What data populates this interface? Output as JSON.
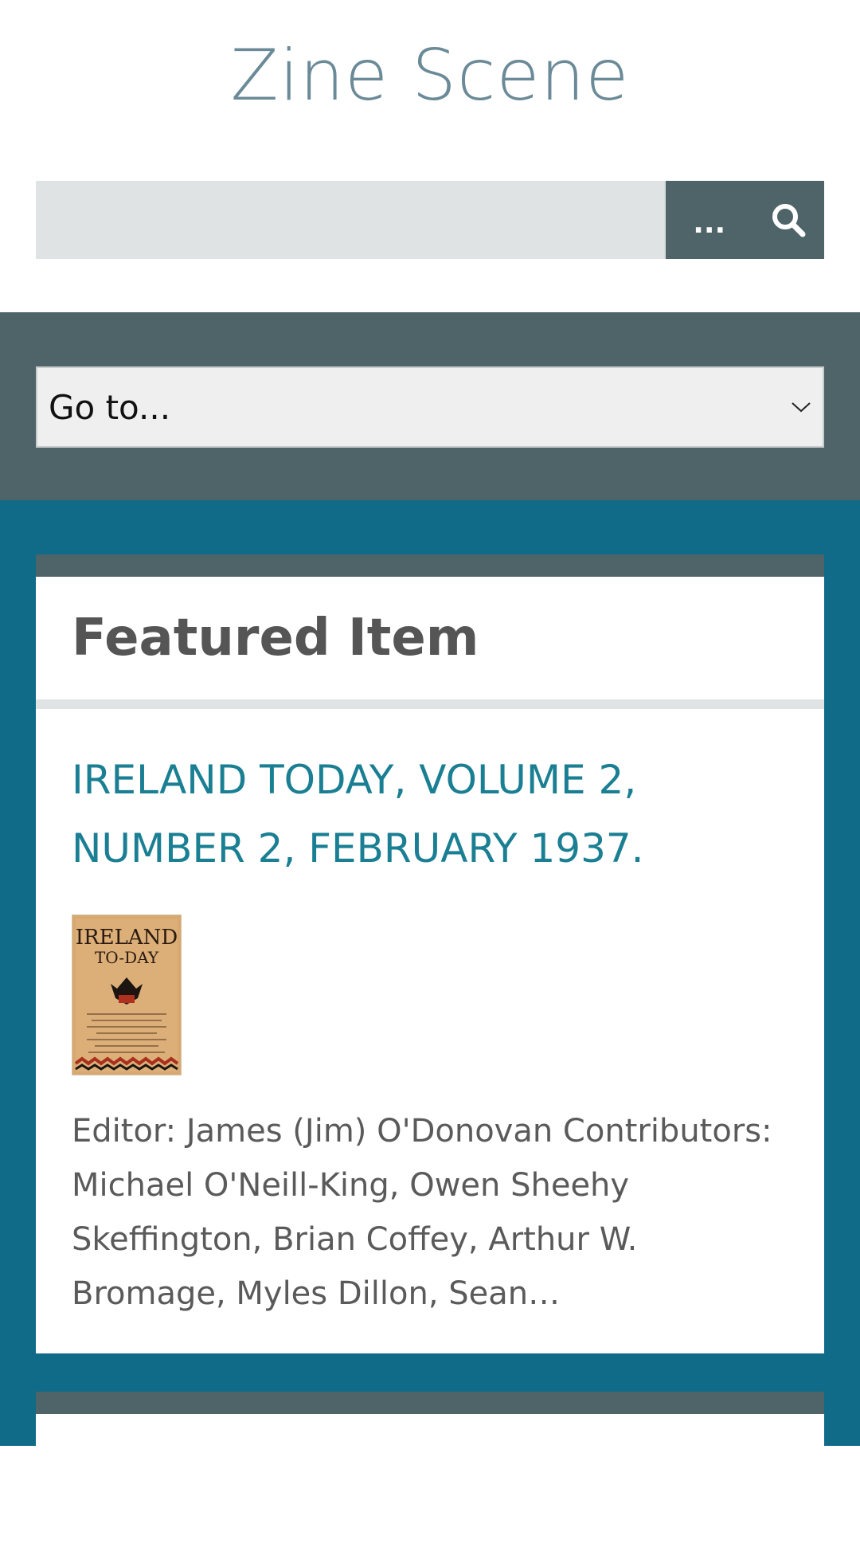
{
  "site": {
    "title": "Zine Scene"
  },
  "search": {
    "value": "",
    "advanced_label": "...",
    "submit_icon": "search-icon"
  },
  "nav": {
    "goto_label": "Go to...",
    "chevron_icon": "chevron-down-icon"
  },
  "featured": {
    "heading": "Featured Item",
    "item_title": "IRELAND TODAY, VOLUME 2, NUMBER 2, FEBRUARY 1937.",
    "thumbnail": {
      "masthead": "IRELAND\nTO-DAY"
    },
    "description": "Editor: James (Jim) O'Donovan Contributors: Michael O'Neill-King, Owen Sheehy Skeffington, Brian Coffey, Arthur W. Bromage, Myles Dillon, Sean…"
  },
  "colors": {
    "title": "#6b8a98",
    "dark_band": "#4f6468",
    "teal_band": "#0f6b88",
    "link": "#1a7f93",
    "input_bg": "#dfe3e4"
  }
}
